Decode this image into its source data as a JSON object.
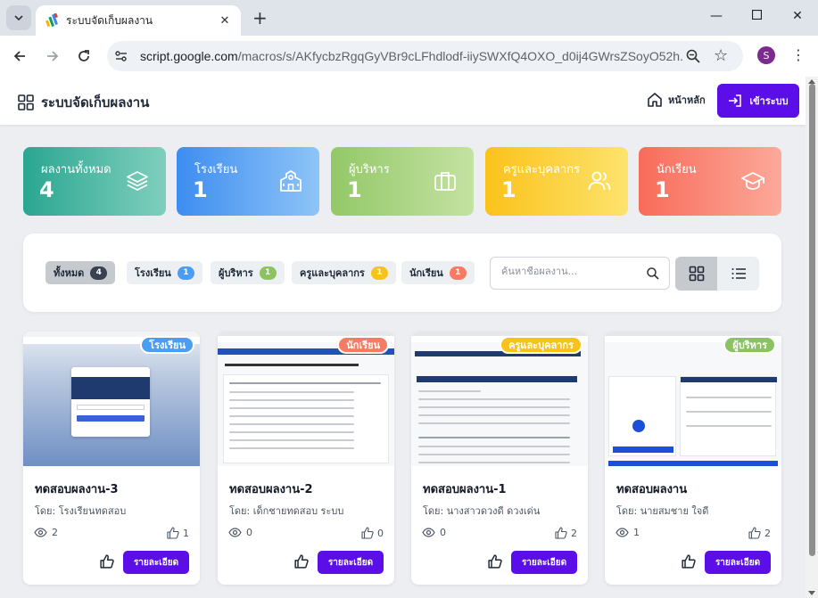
{
  "browser": {
    "tab_title": "ระบบจัดเก็บผลงาน",
    "url_host": "script.google.com",
    "url_path": "/macros/s/AKfycbzRgqGyVBr9cLFhdlodf-iiySWXfQ4OXO_d0ij4GWrsZSoyO52h...",
    "profile_initial": "S"
  },
  "header": {
    "brand": "ระบบจัดเก็บผลงาน",
    "home": "หน้าหลัก",
    "login": "เข้าระบบ"
  },
  "stats": [
    {
      "label": "ผลงานทั้งหมด",
      "value": "4",
      "icon": "layers-icon",
      "colors": [
        "#2aa691",
        "#7fcfbd"
      ]
    },
    {
      "label": "โรงเรียน",
      "value": "1",
      "icon": "school-icon",
      "colors": [
        "#3d8df0",
        "#8ec4f7"
      ]
    },
    {
      "label": "ผู้บริหาร",
      "value": "1",
      "icon": "briefcase-icon",
      "colors": [
        "#93c868",
        "#c4e2a2"
      ]
    },
    {
      "label": "ครูและบุคลากร",
      "value": "1",
      "icon": "users-icon",
      "colors": [
        "#fbc21b",
        "#fde36d"
      ]
    },
    {
      "label": "นักเรียน",
      "value": "1",
      "icon": "graduation-cap-icon",
      "colors": [
        "#f96b5a",
        "#fca99a"
      ]
    }
  ],
  "filters": [
    {
      "label": "ทั้งหมด",
      "count": "4",
      "color": "#374151",
      "active": true
    },
    {
      "label": "โรงเรียน",
      "count": "1",
      "color": "#4a9df2",
      "active": false
    },
    {
      "label": "ผู้บริหาร",
      "count": "1",
      "color": "#8bc45f",
      "active": false
    },
    {
      "label": "ครูและบุคลากร",
      "count": "1",
      "color": "#f8c21a",
      "active": false
    },
    {
      "label": "นักเรียน",
      "count": "1",
      "color": "#f77a63",
      "active": false
    }
  ],
  "search": {
    "placeholder": "ค้นหาชื่อผลงาน..."
  },
  "cards": [
    {
      "badge": "โรงเรียน",
      "badge_color": "#4a9df2",
      "title": "ทดสอบผลงาน-3",
      "by": "โดย: โรงเรียนทดสอบ",
      "views": "2",
      "likes": "1",
      "detail": "รายละเอียด"
    },
    {
      "badge": "นักเรียน",
      "badge_color": "#f77a63",
      "title": "ทดสอบผลงาน-2",
      "by": "โดย: เด็กชายทดสอบ ระบบ",
      "views": "0",
      "likes": "0",
      "detail": "รายละเอียด"
    },
    {
      "badge": "ครูและบุคลากร",
      "badge_color": "#f8c21a",
      "title": "ทดสอบผลงาน-1",
      "by": "โดย: นางสาวดวงดี ดวงเด่น",
      "views": "0",
      "likes": "2",
      "detail": "รายละเอียด"
    },
    {
      "badge": "ผู้บริหาร",
      "badge_color": "#8bc45f",
      "title": "ทดสอบผลงาน",
      "by": "โดย: นายสมชาย ใจดี",
      "views": "1",
      "likes": "2",
      "detail": "รายละเอียด"
    }
  ]
}
